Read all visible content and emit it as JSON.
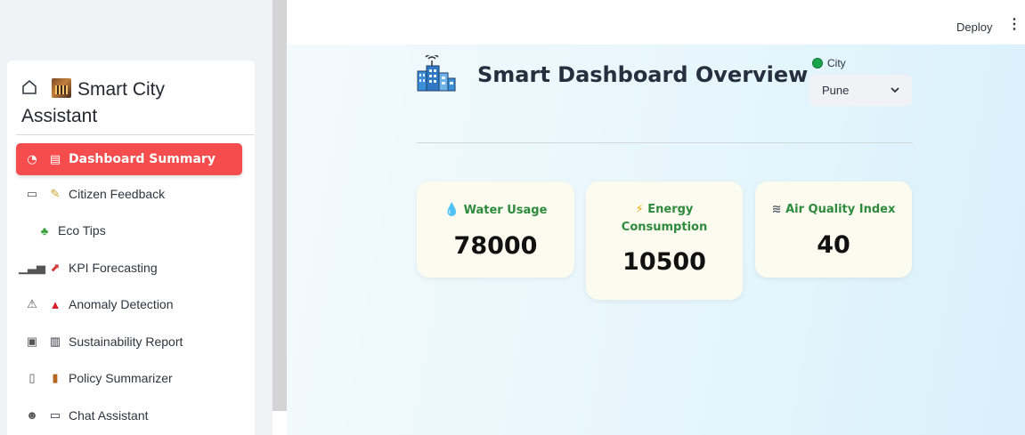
{
  "sidebar": {
    "title_line1": "Smart City",
    "title_line2": "Assistant",
    "items": [
      {
        "label": "Dashboard Summary",
        "icon": "gauge-icon",
        "emoji": "clipboard-icon",
        "active": true
      },
      {
        "label": "Citizen Feedback",
        "icon": "comment-icon",
        "emoji": "memo-icon"
      },
      {
        "label": "Eco Tips",
        "emoji": "seedling-icon"
      },
      {
        "label": "KPI Forecasting",
        "icon": "bar-chart-icon",
        "emoji": "chart-up-icon"
      },
      {
        "label": "Anomaly Detection",
        "icon": "warning-icon",
        "emoji": "alarm-light-icon"
      },
      {
        "label": "Sustainability Report",
        "icon": "report-icon",
        "emoji": "notepad-icon"
      },
      {
        "label": "Policy Summarizer",
        "icon": "document-icon",
        "emoji": "scroll-icon"
      },
      {
        "label": "Chat Assistant",
        "icon": "robot-icon",
        "emoji": "speech-bubble-icon"
      }
    ]
  },
  "header": {
    "deploy_label": "Deploy",
    "menu_icon": "kebab-menu-icon"
  },
  "main": {
    "title": "Smart Dashboard Overview",
    "title_icon": "city-antenna-icon",
    "city": {
      "label": "City",
      "selected": "Pune"
    },
    "cards": {
      "water": {
        "label": "Water Usage",
        "value": "78000",
        "icon": "droplet-icon"
      },
      "energy": {
        "label": "Energy Consumption",
        "value": "10500",
        "icon": "lightning-icon"
      },
      "air": {
        "label": "Air Quality Index",
        "value": "40",
        "icon": "wind-icon"
      }
    }
  },
  "colors": {
    "active_nav": "#f54d4d",
    "card_label": "#2e8a3d",
    "card_bg": "#fbfcef",
    "city_dot": "#1aa34a"
  }
}
